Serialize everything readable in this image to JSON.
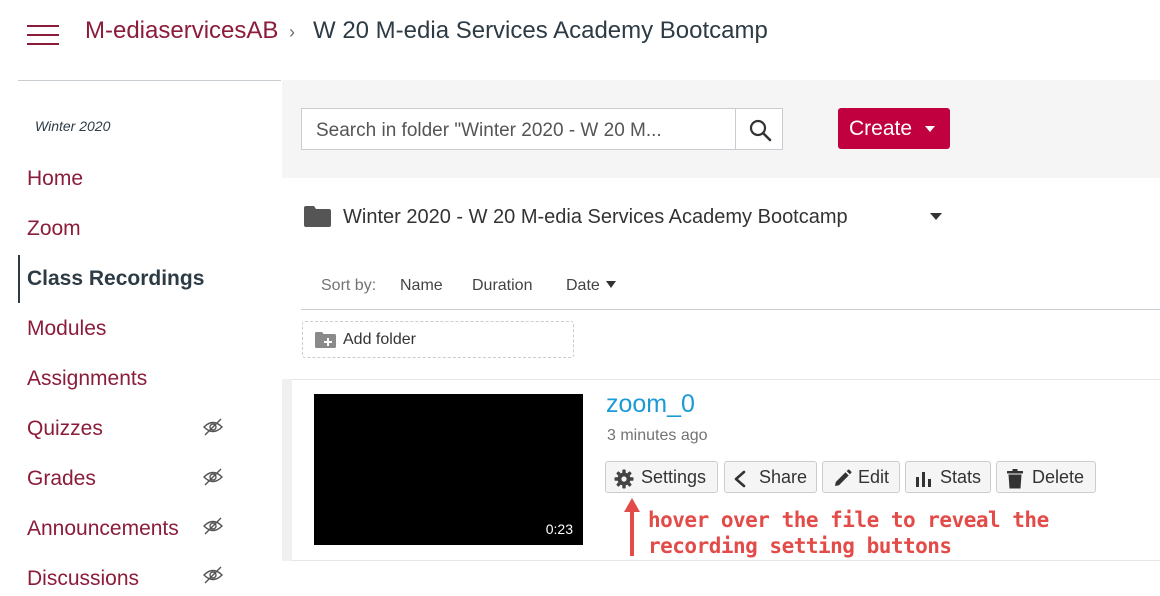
{
  "header": {
    "course": "M-ediaservicesAB",
    "separator": "›",
    "page": "W 20 M-edia Services Academy Bootcamp"
  },
  "sidebar": {
    "term": "Winter 2020",
    "items": [
      {
        "label": "Home",
        "active": false,
        "hidden_icon": false
      },
      {
        "label": "Zoom",
        "active": false,
        "hidden_icon": false
      },
      {
        "label": "Class Recordings",
        "active": true,
        "hidden_icon": false
      },
      {
        "label": "Modules",
        "active": false,
        "hidden_icon": false
      },
      {
        "label": "Assignments",
        "active": false,
        "hidden_icon": false
      },
      {
        "label": "Quizzes",
        "active": false,
        "hidden_icon": true
      },
      {
        "label": "Grades",
        "active": false,
        "hidden_icon": true
      },
      {
        "label": "Announcements",
        "active": false,
        "hidden_icon": true
      },
      {
        "label": "Discussions",
        "active": false,
        "hidden_icon": true
      }
    ]
  },
  "toolbar": {
    "search_placeholder": "Search in folder \"Winter 2020 - W 20 M...",
    "create_label": "Create"
  },
  "folder": {
    "title": "Winter 2020 - W 20 M-edia Services Academy Bootcamp"
  },
  "sort": {
    "label": "Sort by:",
    "options": [
      "Name",
      "Duration",
      "Date"
    ],
    "active": "Date"
  },
  "add_folder_label": "Add folder",
  "session": {
    "name": "zoom_0",
    "time": "3 minutes ago",
    "duration": "0:23",
    "actions": [
      "Settings",
      "Share",
      "Edit",
      "Stats",
      "Delete"
    ]
  },
  "annotation": {
    "line1": "hover over the file to reveal the",
    "line2": "recording setting buttons"
  },
  "colors": {
    "brand": "#8b1c3a",
    "create": "#c0003f",
    "link": "#1a9bd7",
    "annotation": "#e34b48"
  }
}
